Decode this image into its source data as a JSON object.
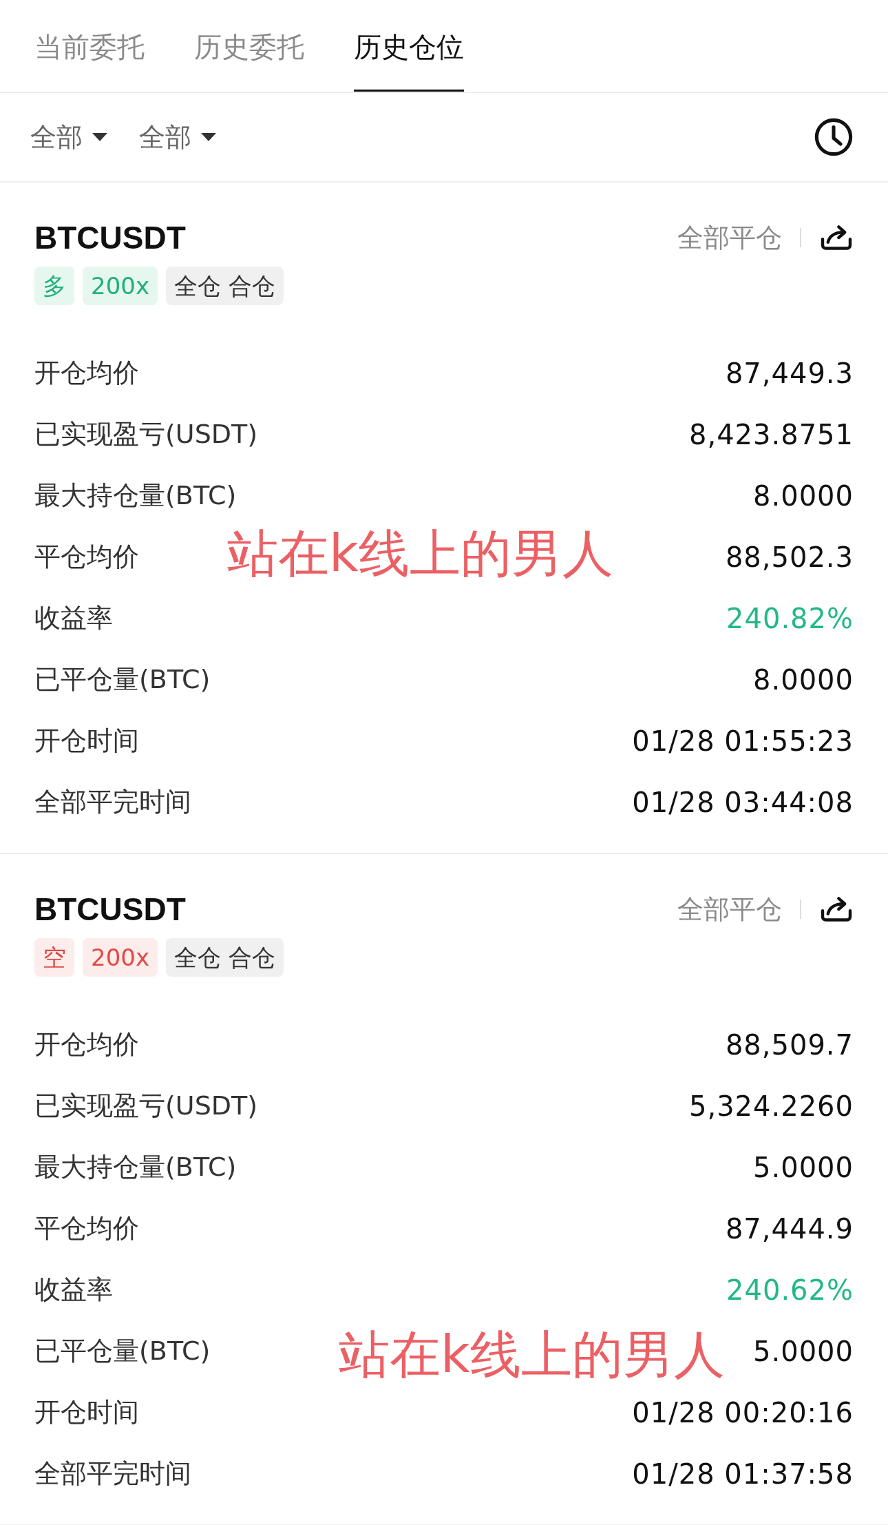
{
  "tabs": [
    {
      "label": "当前委托",
      "selected": false
    },
    {
      "label": "历史委托",
      "selected": false
    },
    {
      "label": "历史仓位",
      "selected": true
    }
  ],
  "filters": [
    {
      "label": "全部"
    },
    {
      "label": "全部"
    }
  ],
  "positions": [
    {
      "symbol": "BTCUSDT",
      "close_all": "全部平仓",
      "tags": [
        {
          "text": "多",
          "kind": "long"
        },
        {
          "text": "200x",
          "kind": "long"
        },
        {
          "text": "全仓 合仓",
          "kind": "neutral"
        }
      ],
      "rows": [
        {
          "label": "开仓均价",
          "value": "87,449.3",
          "kind": "plain"
        },
        {
          "label": "已实现盈亏(USDT)",
          "value": "8,423.8751",
          "kind": "plain"
        },
        {
          "label": "最大持仓量(BTC)",
          "value": "8.0000",
          "kind": "plain"
        },
        {
          "label": "平仓均价",
          "value": "88,502.3",
          "kind": "plain"
        },
        {
          "label": "收益率",
          "value": "240.82%",
          "kind": "gain"
        },
        {
          "label": "已平仓量(BTC)",
          "value": "8.0000",
          "kind": "plain"
        },
        {
          "label": "开仓时间",
          "value": "01/28 01:55:23",
          "kind": "plain"
        },
        {
          "label": "全部平完时间",
          "value": "01/28 03:44:08",
          "kind": "plain"
        }
      ],
      "annotation": "站在k线上的男人"
    },
    {
      "symbol": "BTCUSDT",
      "close_all": "全部平仓",
      "tags": [
        {
          "text": "空",
          "kind": "short"
        },
        {
          "text": "200x",
          "kind": "short"
        },
        {
          "text": "全仓 合仓",
          "kind": "neutral"
        }
      ],
      "rows": [
        {
          "label": "开仓均价",
          "value": "88,509.7",
          "kind": "plain"
        },
        {
          "label": "已实现盈亏(USDT)",
          "value": "5,324.2260",
          "kind": "plain"
        },
        {
          "label": "最大持仓量(BTC)",
          "value": "5.0000",
          "kind": "plain"
        },
        {
          "label": "平仓均价",
          "value": "87,444.9",
          "kind": "plain"
        },
        {
          "label": "收益率",
          "value": "240.62%",
          "kind": "gain"
        },
        {
          "label": "已平仓量(BTC)",
          "value": "5.0000",
          "kind": "plain"
        },
        {
          "label": "开仓时间",
          "value": "01/28 00:20:16",
          "kind": "plain"
        },
        {
          "label": "全部平完时间",
          "value": "01/28 01:37:58",
          "kind": "plain"
        }
      ],
      "annotation": "站在k线上的男人"
    }
  ]
}
